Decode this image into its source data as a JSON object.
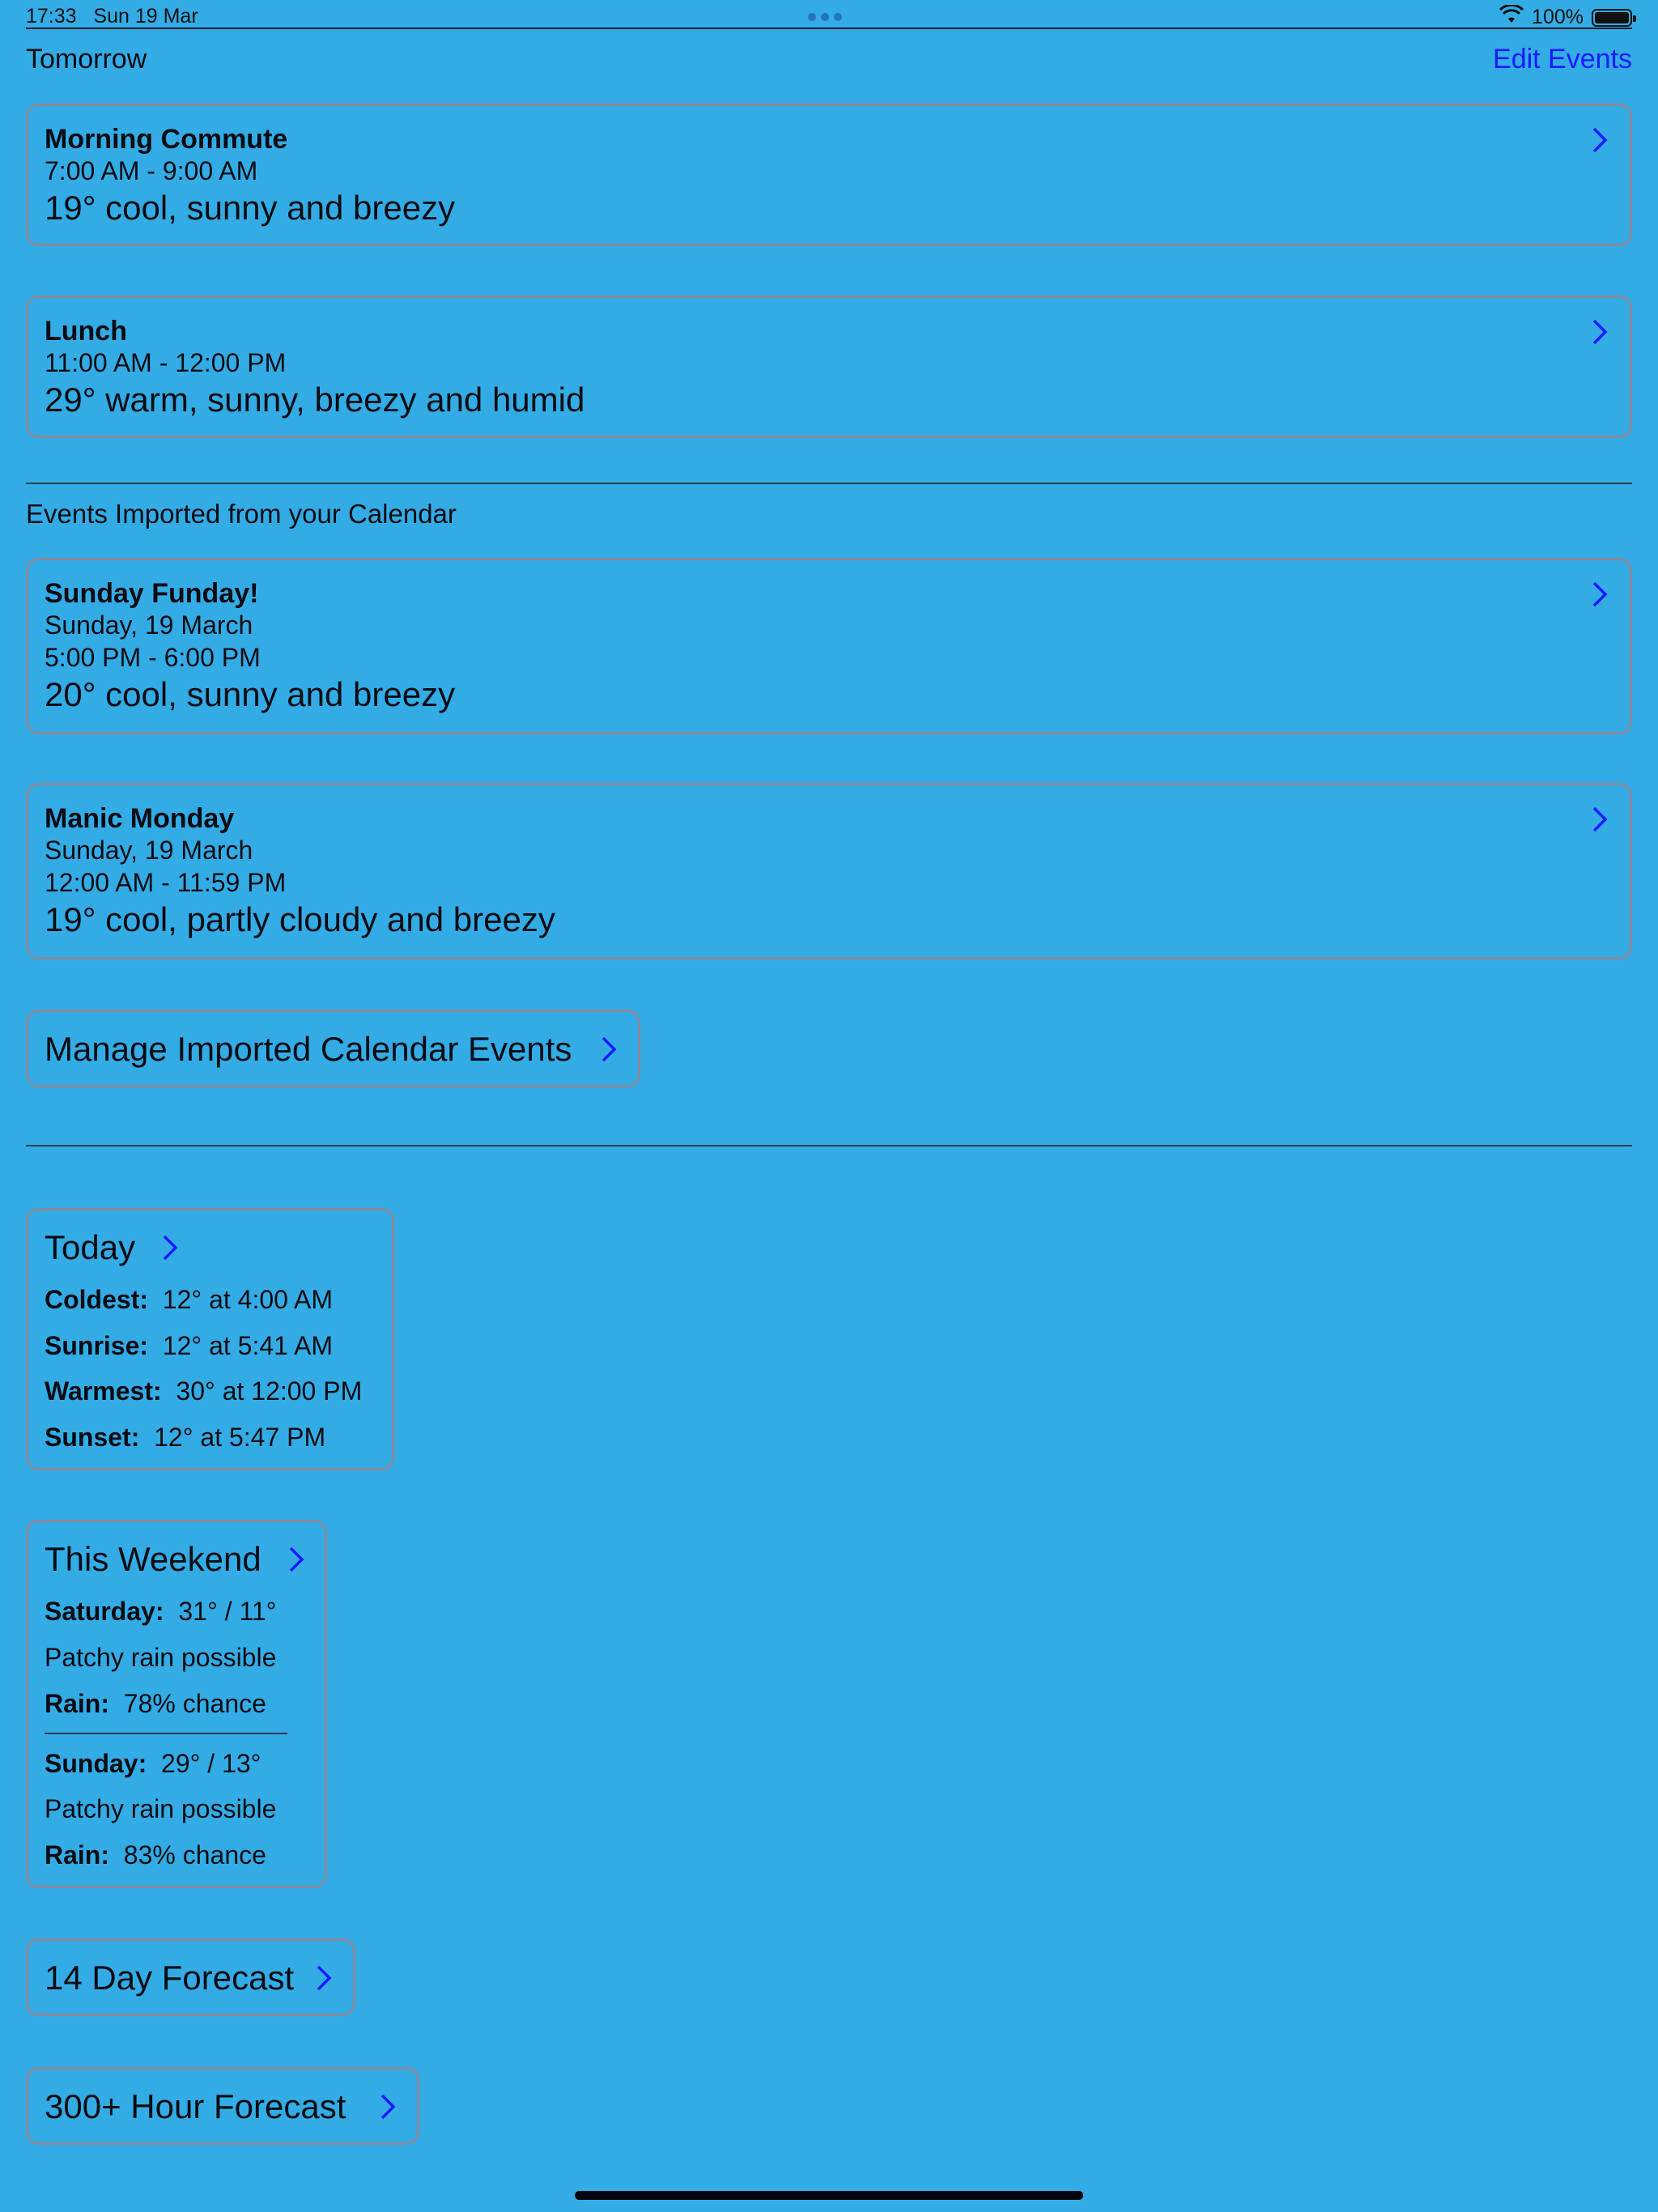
{
  "status_bar": {
    "time": "17:33",
    "date": "Sun 19 Mar",
    "battery": "100%"
  },
  "header": {
    "title": "Tomorrow",
    "edit_label": "Edit Events"
  },
  "events": [
    {
      "title": "Morning Commute",
      "time": "7:00 AM  -  9:00 AM",
      "weather": "19° cool, sunny and breezy"
    },
    {
      "title": "Lunch",
      "time": "11:00 AM  -  12:00 PM",
      "weather": "29° warm, sunny, breezy and humid"
    }
  ],
  "imported_header": "Events Imported from your Calendar",
  "imported": [
    {
      "title": "Sunday Funday!",
      "date": "Sunday, 19 March",
      "time": "5:00 PM  -  6:00 PM",
      "weather": "20° cool, sunny and breezy"
    },
    {
      "title": "Manic Monday",
      "date": "Sunday, 19 March",
      "time": "12:00 AM  -  11:59 PM",
      "weather": "19° cool, partly cloudy and breezy"
    }
  ],
  "manage_label": "Manage Imported Calendar Events",
  "today": {
    "title": "Today",
    "rows": [
      {
        "label": "Coldest:",
        "value": "12°  at  4:00 AM"
      },
      {
        "label": "Sunrise:",
        "value": "12°  at  5:41 AM"
      },
      {
        "label": "Warmest:",
        "value": "30°  at  12:00 PM"
      },
      {
        "label": "Sunset:",
        "value": "12°  at  5:47 PM"
      }
    ]
  },
  "weekend": {
    "title": "This Weekend",
    "days": [
      {
        "label": "Saturday:",
        "temps": "31°  /  11°",
        "desc": "Patchy rain possible",
        "rain_label": "Rain:",
        "rain": "78% chance"
      },
      {
        "label": "Sunday:",
        "temps": "29°  /  13°",
        "desc": "Patchy rain possible",
        "rain_label": "Rain:",
        "rain": "83% chance"
      }
    ]
  },
  "forecast14_label": "14 Day Forecast",
  "forecast300_label": "300+ Hour Forecast",
  "colors": {
    "background": "#33ace6",
    "link": "#1a1aff",
    "card_border": "#8a8a9e"
  }
}
